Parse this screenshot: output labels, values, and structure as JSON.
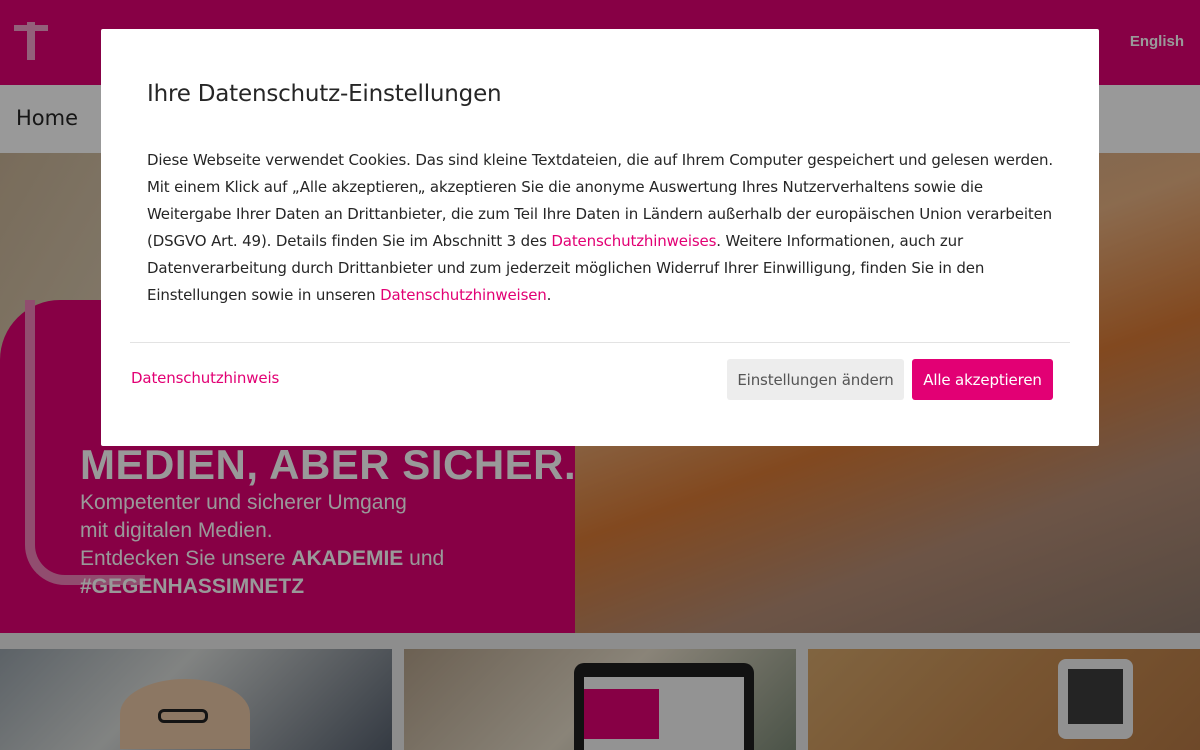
{
  "header": {
    "logo_icon": "telekom-t-logo-icon",
    "language_link": "English",
    "brand_color": "#e20074"
  },
  "subnav": {
    "home_link": "Home"
  },
  "hero": {
    "title": "MEDIEN, ABER SICHER.",
    "subtitle_line1": "Kompetenter und sicherer Umgang",
    "subtitle_line2": "mit digitalen Medien.",
    "subtitle_line3_pre": "Entdecken Sie unsere ",
    "subtitle_line3_bold": "AKADEMIE",
    "subtitle_line3_post": " und",
    "subtitle_line4": "#GEGENHASSIMNETZ"
  },
  "cookie_modal": {
    "title": "Ihre Datenschutz-Einstellungen",
    "body_part1": "Diese Webseite verwendet Cookies. Das sind kleine Textdateien, die auf Ihrem Computer gespeichert und gelesen werden. Mit einem Klick auf „Alle akzeptieren„ akzeptieren Sie die anonyme Auswertung Ihres Nutzerverhaltens sowie die Weitergabe Ihrer Daten an Drittanbieter, die zum Teil Ihre Daten in Ländern außerhalb der europäischen Union verarbeiten (DSGVO Art. 49). Details finden Sie im Abschnitt 3 des ",
    "body_link1": "Datenschutzhinweises",
    "body_part2": ". Weitere Informationen, auch zur Datenverarbeitung durch Drittanbieter und zum jederzeit möglichen Widerruf Ihrer Einwilligung, finden Sie in den Einstellungen sowie in unseren ",
    "body_link2": "Datenschutzhinweisen",
    "body_part3": ".",
    "footer_link": "Datenschutzhinweis",
    "settings_button": "Einstellungen ändern",
    "accept_button": "Alle akzeptieren"
  }
}
